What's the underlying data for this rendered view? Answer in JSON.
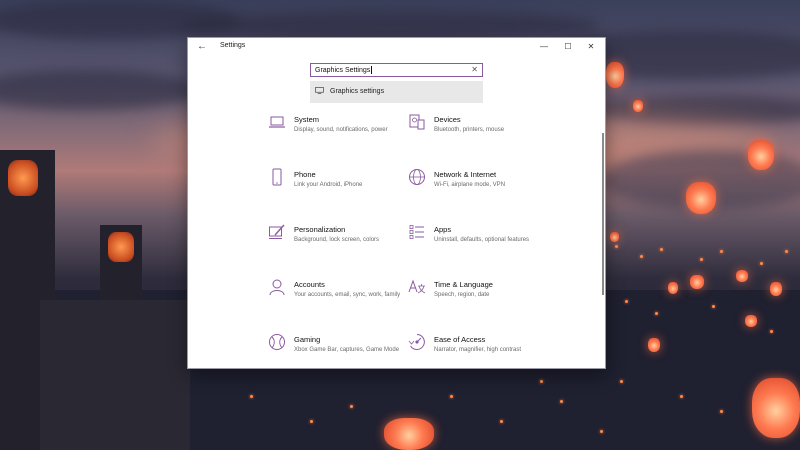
{
  "window": {
    "title": "Settings",
    "back_icon": "back-arrow-icon",
    "minimize_icon": "minimize-icon",
    "maximize_icon": "maximize-icon",
    "close_icon": "close-icon"
  },
  "search": {
    "value": "Graphics Settings",
    "clear_icon": "clear-icon"
  },
  "suggestion": {
    "label": "Graphics settings",
    "icon": "monitor-icon"
  },
  "categories": [
    {
      "id": "system",
      "title": "System",
      "desc": "Display, sound, notifications, power",
      "icon": "laptop-icon"
    },
    {
      "id": "devices",
      "title": "Devices",
      "desc": "Bluetooth, printers, mouse",
      "icon": "devices-icon"
    },
    {
      "id": "phone",
      "title": "Phone",
      "desc": "Link your Android, iPhone",
      "icon": "phone-icon"
    },
    {
      "id": "network",
      "title": "Network & Internet",
      "desc": "Wi-Fi, airplane mode, VPN",
      "icon": "globe-icon"
    },
    {
      "id": "personalization",
      "title": "Personalization",
      "desc": "Background, lock screen, colors",
      "icon": "brush-icon"
    },
    {
      "id": "apps",
      "title": "Apps",
      "desc": "Uninstall, defaults, optional features",
      "icon": "apps-list-icon"
    },
    {
      "id": "accounts",
      "title": "Accounts",
      "desc": "Your accounts, email, sync, work, family",
      "icon": "person-icon"
    },
    {
      "id": "time",
      "title": "Time & Language",
      "desc": "Speech, region, date",
      "icon": "language-icon"
    },
    {
      "id": "gaming",
      "title": "Gaming",
      "desc": "Xbox Game Bar, captures, Game Mode",
      "icon": "xbox-icon"
    },
    {
      "id": "ease",
      "title": "Ease of Access",
      "desc": "Narrator, magnifier, high contrast",
      "icon": "ease-of-access-icon"
    }
  ],
  "colors": {
    "accent": "#8a5aa0",
    "icon": "#8a5aa0"
  }
}
